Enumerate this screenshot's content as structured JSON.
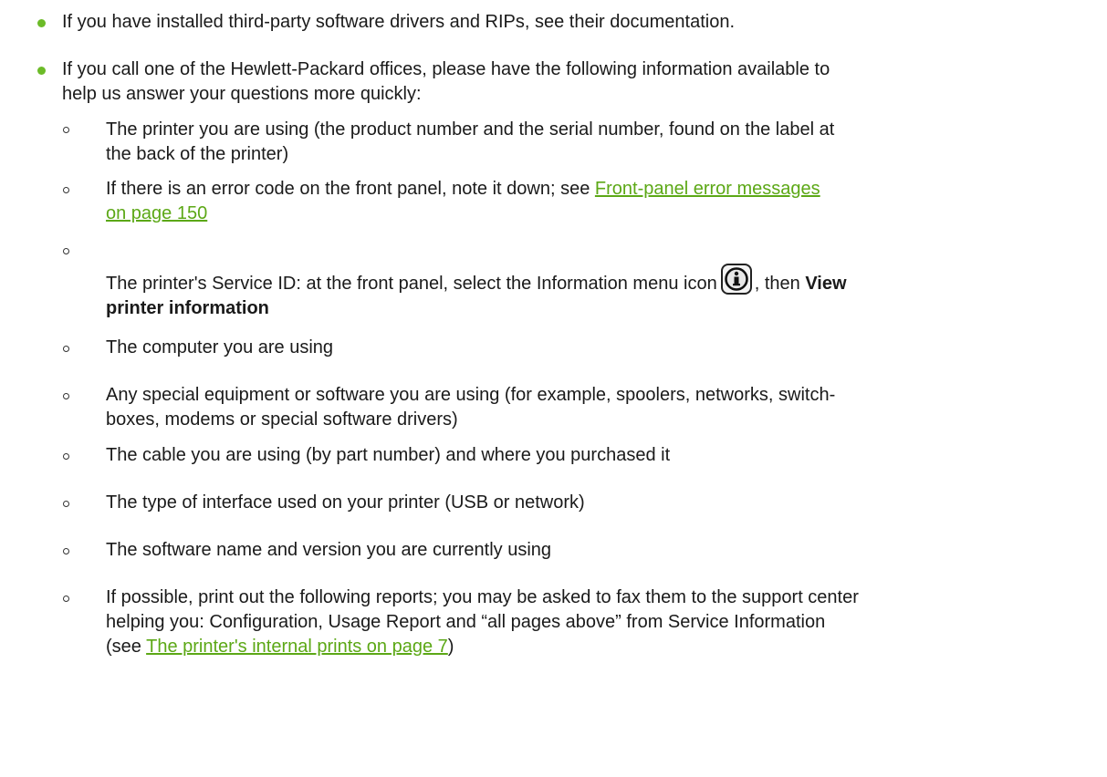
{
  "items": [
    {
      "text": "If you have installed third-party software drivers and RIPs, see their documentation."
    },
    {
      "text": "If you call one of the Hewlett-Packard offices, please have the following information available to help us answer your questions more quickly:",
      "line1": "If you call one of the Hewlett-Packard offices, please have the following information available to",
      "line2": "help us answer your questions more quickly:"
    }
  ],
  "subitems": {
    "printer": {
      "line1": "The printer you are using (the product number and the serial number, found on the label at",
      "line2": "the back of the printer)"
    },
    "error_code": {
      "prefix": "If there is an error code on the front panel, note it down; see ",
      "link_line1": "Front-panel error messages",
      "link_line2": "on page 150"
    },
    "service_id": {
      "prefix": "The printer's Service ID: at the front panel, select the Information menu icon",
      "middle": ", then ",
      "bold1": "View",
      "bold2": "printer information",
      "icon": "information-menu-icon"
    },
    "computer": "The computer you are using",
    "equipment": {
      "line1": "Any special equipment or software you are using (for example, spoolers, networks, switch-",
      "line2": "boxes, modems or special software drivers)"
    },
    "cable": "The cable you are using (by part number) and where you purchased it",
    "interface": "The type of interface used on your printer (USB or network)",
    "software": "The software name and version you are currently using",
    "reports": {
      "line1": "If possible, print out the following reports; you may be asked to fax them to the support center",
      "line2": "helping you: Configuration, Usage Report and “all pages above” from Service Information",
      "line3_prefix": "(see ",
      "link": "The printer's internal prints on page 7",
      "line3_suffix": ")"
    }
  },
  "colors": {
    "bullet": "#6cbb28",
    "link": "#5ca816",
    "text": "#1a1a1a"
  }
}
